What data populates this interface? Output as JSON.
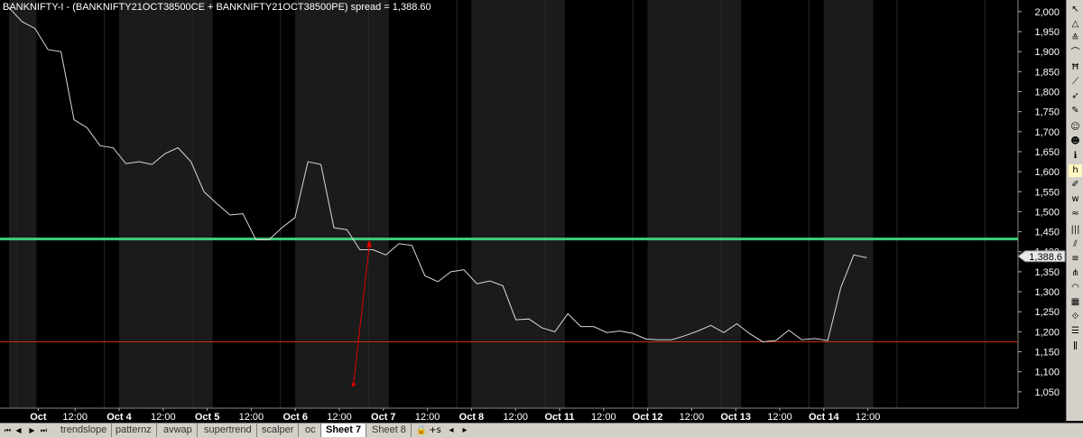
{
  "title": "BANKNIFTY-I - (BANKNIFTY21OCT38500CE + BANKNIFTY21OCT38500PE) spread = 1,388.60",
  "price_tag": "1,388.6",
  "tabs": {
    "trendslope": "trendslope",
    "patternz": "patternz",
    "avwap": "avwap",
    "supertrend": "supertrend",
    "scalper": "scalper",
    "oc": "oc",
    "sheet7": "Sheet 7",
    "sheet8": "Sheet 8"
  },
  "icons": [
    "first-icon",
    "prev-icon",
    "next-icon",
    "last-icon",
    "lock-icon",
    "split-tab-icon",
    "prev-sheet-icon",
    "next-sheet-icon"
  ],
  "colors": {
    "background": "#000000",
    "band": "#1b1b1b",
    "line": "#d9d9d9",
    "green_level": "#3ecf7a",
    "red_level": "#c03010",
    "arrow": "#e00000"
  },
  "chart_data": {
    "type": "line",
    "ylim": [
      1000,
      2020
    ],
    "yticks": [
      "2,000",
      "1,950",
      "1,900",
      "1,850",
      "1,800",
      "1,750",
      "1,700",
      "1,650",
      "1,600",
      "1,550",
      "1,500",
      "1,450",
      "1,400",
      "1,350",
      "1,300",
      "1,250",
      "1,200",
      "1,150",
      "1,100",
      "1,050"
    ],
    "ytick_values": [
      2000,
      1950,
      1900,
      1850,
      1800,
      1750,
      1700,
      1650,
      1600,
      1550,
      1500,
      1450,
      1400,
      1350,
      1300,
      1250,
      1200,
      1150,
      1100,
      1050
    ],
    "xlabels": [
      "Oct",
      "12:00",
      "Oct 4",
      "12:00",
      "Oct 5",
      "12:00",
      "Oct 6",
      "12:00",
      "Oct 7",
      "12:00",
      "Oct 8",
      "12:00",
      "Oct 11",
      "12:00",
      "Oct 12",
      "12:00",
      "Oct 13",
      "12:00",
      "Oct 14",
      "12:00"
    ],
    "bar_index_count": 96,
    "xlabel_bars": [
      2,
      6,
      10,
      14,
      18,
      22,
      26,
      30,
      34,
      38,
      42,
      46,
      50,
      54,
      58,
      62,
      66,
      70,
      74,
      78
    ],
    "band_bar_ranges": [
      [
        0,
        2
      ],
      [
        10,
        18
      ],
      [
        26,
        34
      ],
      [
        42,
        50
      ],
      [
        58,
        66
      ],
      [
        74,
        78
      ]
    ],
    "series": [
      {
        "values": [
          2010,
          1975,
          1958,
          1905,
          1900,
          1730,
          1710,
          1665,
          1660,
          1620,
          1625,
          1618,
          1645,
          1660,
          1625,
          1550,
          1520,
          1492,
          1495,
          1430,
          1430,
          1460,
          1485,
          1625,
          1618,
          1460,
          1455,
          1405,
          1405,
          1392,
          1420,
          1416,
          1340,
          1325,
          1350,
          1355,
          1320,
          1327,
          1315,
          1230,
          1232,
          1210,
          1200,
          1245,
          1213,
          1213,
          1198,
          1202,
          1196,
          1182,
          1180,
          1180,
          1190,
          1202,
          1216,
          1198,
          1220,
          1195,
          1175,
          1178,
          1204,
          1180,
          1183,
          1178,
          1310,
          1392,
          1385
        ]
      }
    ],
    "hlines": [
      1432,
      1175
    ],
    "arrow": {
      "from_bar": 26.5,
      "from_value": 1068,
      "to_bar": 28,
      "to_value": 1430
    },
    "last_value": 1388.6
  }
}
